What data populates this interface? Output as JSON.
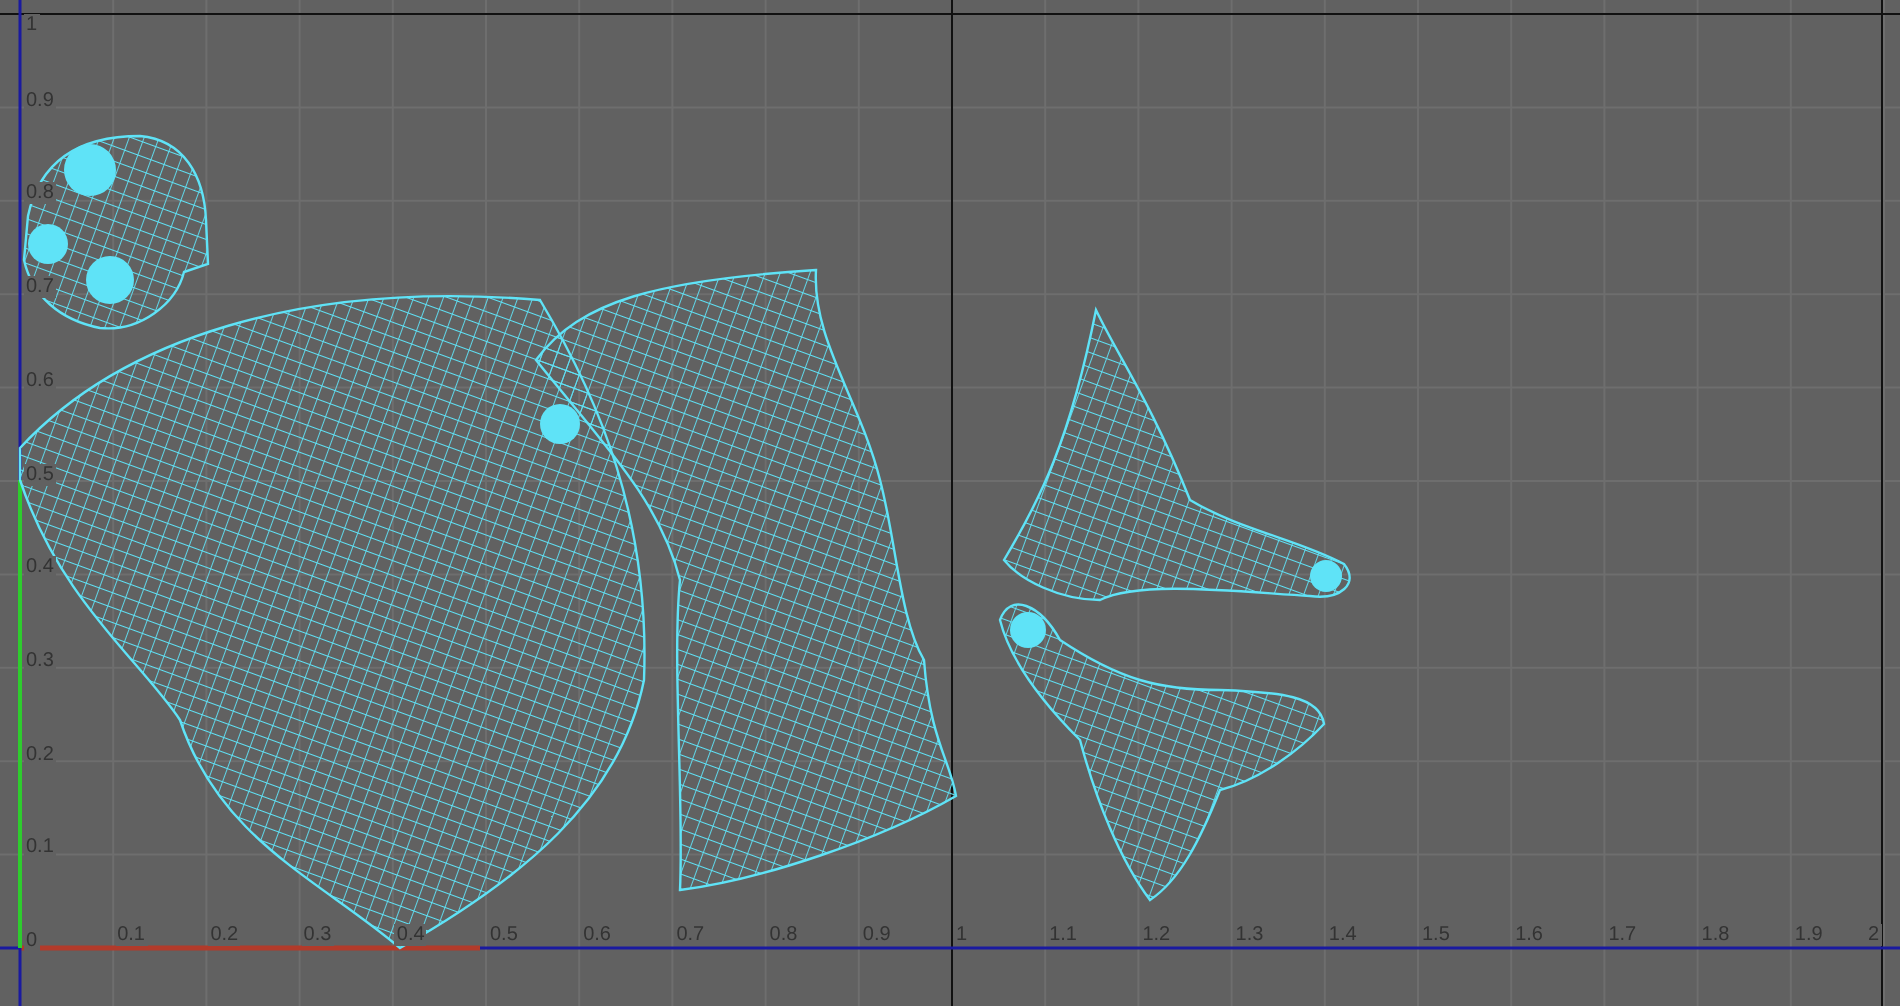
{
  "uv_editor": {
    "v_labels": [
      "1",
      "0.9",
      "0.8",
      "0.7",
      "0.6",
      "0.5",
      "0.4",
      "0.3",
      "0.2",
      "0.1",
      "0"
    ],
    "u_labels": [
      "0.1",
      "0.2",
      "0.3",
      "0.4",
      "0.5",
      "0.6",
      "0.7",
      "0.8",
      "0.9",
      "1",
      "1.1",
      "1.2",
      "1.3",
      "1.4",
      "1.5",
      "1.6",
      "1.7",
      "1.8",
      "1.9",
      "2"
    ]
  }
}
